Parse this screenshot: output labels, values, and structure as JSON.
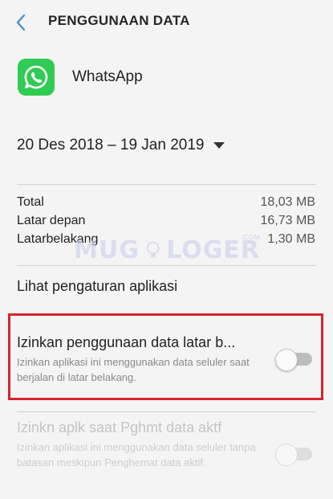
{
  "header": {
    "title": "PENGGUNAAN DATA",
    "back_icon": "chevron-left-icon"
  },
  "app": {
    "name": "WhatsApp",
    "icon": "whatsapp-icon",
    "icon_color": "#2fcb52"
  },
  "period": {
    "label": "20 Des 2018 – 19 Jan 2019",
    "icon": "caret-down-icon"
  },
  "usage": [
    {
      "label": "Total",
      "value": "18,03 MB"
    },
    {
      "label": "Latar depan",
      "value": "16,73 MB"
    },
    {
      "label": "Latarbelakang",
      "value": "1,30 MB"
    }
  ],
  "watermark": {
    "left": "MUG",
    "right": "LOGER",
    "suffix": ".COM"
  },
  "app_settings_link": "Lihat pengaturan aplikasi",
  "settings": [
    {
      "title": "Izinkan penggunaan data latar b...",
      "description": "Izinkan aplikasi ini menggunakan data seluler saat berjalan di latar belakang.",
      "enabled": true,
      "on": false
    },
    {
      "title": "Izinkn aplk saat Pghmt data aktf",
      "description": "Izinkan aplikasi ini menggunakan data seluler tanpa batasan meskipun Penghemat data aktif.",
      "enabled": false,
      "on": false
    }
  ],
  "colors": {
    "highlight": "#d9232e",
    "background": "#f4f4f4",
    "accent": "#4a90c8"
  }
}
